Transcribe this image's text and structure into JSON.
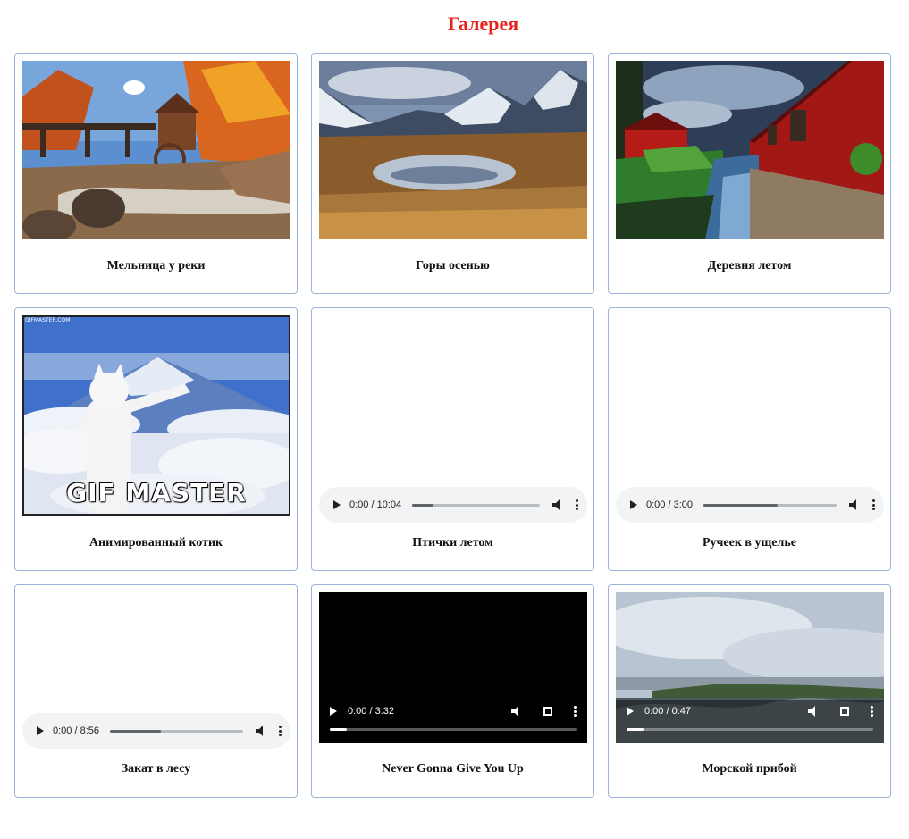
{
  "page": {
    "title": "Галерея"
  },
  "items": [
    {
      "type": "image",
      "caption": "Мельница у реки"
    },
    {
      "type": "image",
      "caption": "Горы осенью"
    },
    {
      "type": "image",
      "caption": "Деревня летом"
    },
    {
      "type": "gif",
      "caption": "Анимированный котик",
      "overlay_text": "GIF MASTER",
      "watermark": "GIFMASTER.COM"
    },
    {
      "type": "audio",
      "caption": "Птички летом",
      "time": "0:00 / 10:04",
      "progress": 0.17
    },
    {
      "type": "audio",
      "caption": "Ручеек в ущелье",
      "time": "0:00 / 3:00",
      "progress": 0.56
    },
    {
      "type": "audio",
      "caption": "Закат в лесу",
      "time": "0:00 / 8:56",
      "progress": 0.38
    },
    {
      "type": "video",
      "caption": "Never Gonna Give You Up",
      "time": "0:00 / 3:32",
      "progress": 0.07
    },
    {
      "type": "video",
      "caption": "Морской прибой",
      "time": "0:00 / 0:47",
      "progress": 0.07
    }
  ]
}
